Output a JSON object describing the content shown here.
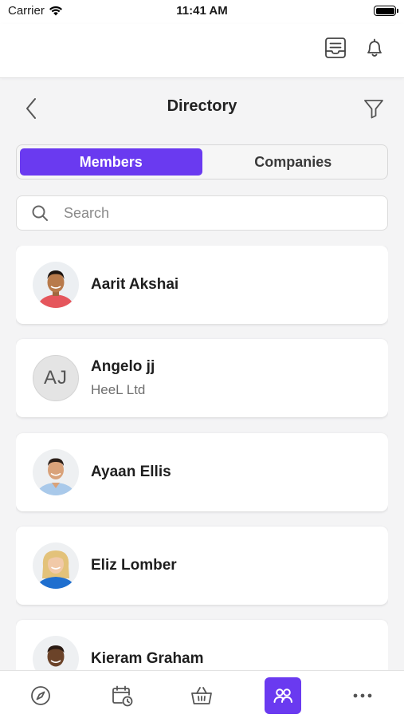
{
  "status_bar": {
    "carrier": "Carrier",
    "time": "11:41 AM",
    "battery_level": 1.0
  },
  "header": {
    "icons": [
      "document-icon",
      "bell-icon"
    ]
  },
  "nav": {
    "title": "Directory",
    "back_icon": "chevron-left-icon",
    "filter_icon": "filter-icon"
  },
  "segments": {
    "members_label": "Members",
    "companies_label": "Companies",
    "selected": "Members"
  },
  "search": {
    "placeholder": "Search",
    "value": ""
  },
  "members": [
    {
      "name": "Aarit Akshai",
      "company": "",
      "avatar": "photo"
    },
    {
      "name": "Angelo jj",
      "company": "HeeL Ltd",
      "avatar": "initials",
      "initials": "AJ"
    },
    {
      "name": "Ayaan Ellis",
      "company": "",
      "avatar": "photo"
    },
    {
      "name": "Eliz Lomber",
      "company": "",
      "avatar": "photo"
    },
    {
      "name": "Kieram Graham",
      "company": "",
      "avatar": "photo"
    }
  ],
  "tab_bar": {
    "tabs": [
      "compass-icon",
      "calendar-clock-icon",
      "basket-icon",
      "people-icon",
      "more-icon"
    ],
    "active": "people-icon"
  },
  "colors": {
    "accent": "#6a3af0",
    "background": "#f4f4f5",
    "card": "#ffffff"
  }
}
